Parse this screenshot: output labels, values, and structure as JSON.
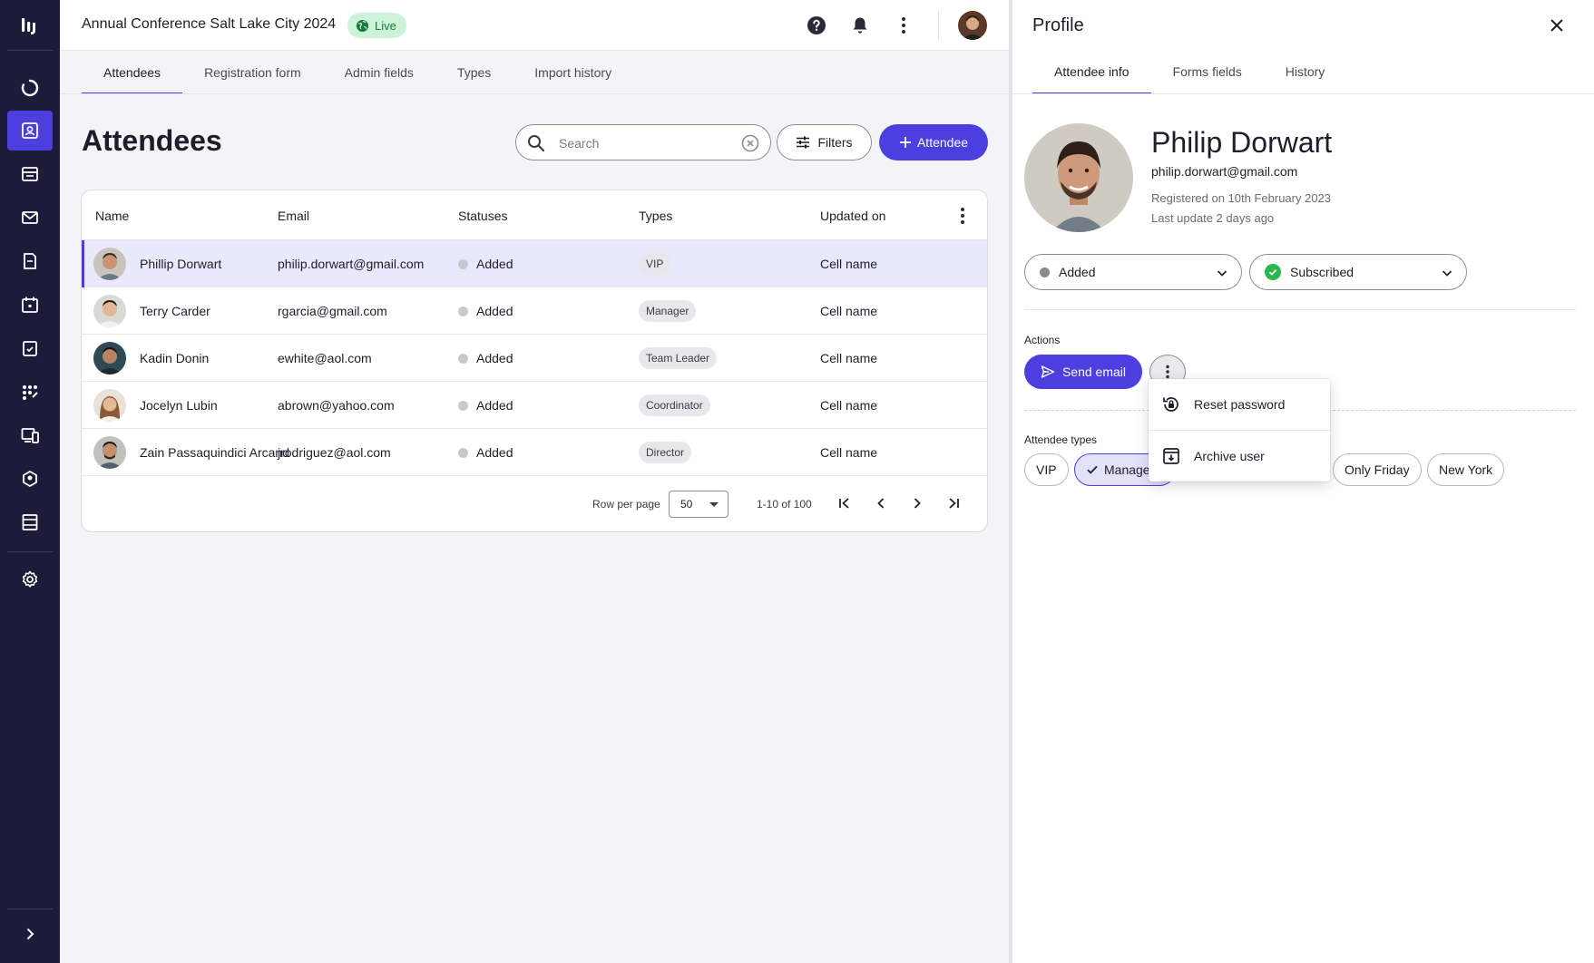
{
  "app": {
    "event_title": "Annual Conference Salt Lake City 2024",
    "live_label": "Live"
  },
  "rail": {
    "items": [
      "dashboard-icon",
      "attendees-icon",
      "agenda-icon",
      "mail-icon",
      "documents-icon",
      "calendar-icon",
      "tasks-icon",
      "apps-icon",
      "devices-icon",
      "badge-icon",
      "layout-icon"
    ],
    "active": "attendees-icon",
    "settings_icon": "gear-icon",
    "expand_icon": "chevron-right-icon"
  },
  "main": {
    "tabs": [
      {
        "label": "Attendees"
      },
      {
        "label": "Registration form"
      },
      {
        "label": "Admin fields"
      },
      {
        "label": "Types"
      },
      {
        "label": "Import history"
      }
    ],
    "active_tab": "Attendees",
    "page_title": "Attendees",
    "search": {
      "placeholder": "Search",
      "value": ""
    },
    "filters_label": "Filters",
    "add_label": "Attendee"
  },
  "table": {
    "columns": [
      "Name",
      "Email",
      "Statuses",
      "Types",
      "Updated on"
    ],
    "rows": [
      {
        "name": "Phillip Dorwart",
        "email": "philip.dorwart@gmail.com",
        "status": "Added",
        "type": "VIP",
        "updated": "Cell name",
        "selected": true
      },
      {
        "name": "Terry Carder",
        "email": "rgarcia@gmail.com",
        "status": "Added",
        "type": "Manager",
        "updated": "Cell name"
      },
      {
        "name": "Kadin Donin",
        "email": "ewhite@aol.com",
        "status": "Added",
        "type": "Team Leader",
        "updated": "Cell name"
      },
      {
        "name": "Jocelyn Lubin",
        "email": "abrown@yahoo.com",
        "status": "Added",
        "type": "Coordinator",
        "updated": "Cell name"
      },
      {
        "name": "Zain Passaquindici Arcand",
        "email": "jrodriguez@aol.com",
        "status": "Added",
        "type": "Director",
        "updated": "Cell name"
      }
    ],
    "pagination": {
      "rows_per_page_label": "Row per page",
      "rows_per_page": "50",
      "range": "1-10 of 100"
    }
  },
  "profile": {
    "title": "Profile",
    "tabs": [
      {
        "label": "Attendee info"
      },
      {
        "label": "Forms fields"
      },
      {
        "label": "History"
      }
    ],
    "active_tab": "Attendee info",
    "name": "Philip Dorwart",
    "email": "philip.dorwart@gmail.com",
    "registered": "Registered on 10th February 2023",
    "last_update": "Last update 2 days ago",
    "status_value": "Added",
    "subscription_value": "Subscribed",
    "actions_label": "Actions",
    "send_email_label": "Send email",
    "menu": [
      {
        "label": "Reset password",
        "icon": "reset-password-icon"
      },
      {
        "label": "Archive user",
        "icon": "archive-icon"
      }
    ],
    "attendee_types_label": "Attendee types",
    "types": [
      {
        "label": "VIP",
        "selected": false
      },
      {
        "label": "Manager",
        "selected": true
      },
      {
        "label": "Only Friday",
        "selected": false
      },
      {
        "label": "New York",
        "selected": false
      }
    ]
  },
  "colors": {
    "primary": "#4b3fe0",
    "rail": "#1e1b3a",
    "live_bg": "#ccf2d9",
    "success": "#2db84d"
  }
}
